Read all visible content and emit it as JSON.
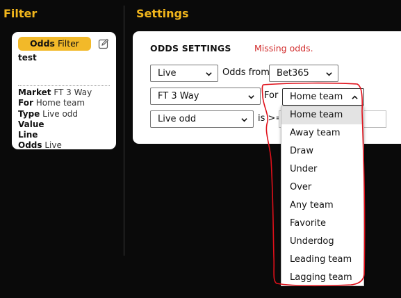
{
  "filter_section": {
    "heading": "Filter",
    "card": {
      "badge_bold": "Odds",
      "badge_rest": "Filter",
      "name": "test",
      "props": [
        {
          "key": "Market",
          "value": "FT 3 Way"
        },
        {
          "key": "For",
          "value": "Home team"
        },
        {
          "key": "Type",
          "value": "Live odd"
        },
        {
          "key": "Value",
          "value": ""
        },
        {
          "key": "Line",
          "value": ""
        },
        {
          "key": "Odds",
          "value": "Live"
        }
      ]
    }
  },
  "settings_section": {
    "heading": "Settings",
    "title": "ODDS SETTINGS",
    "warning": "Missing odds.",
    "mode_select": "Live",
    "odds_from_label": "Odds from",
    "bookmaker_select": "Bet365",
    "market_select": "FT 3 Way",
    "for_label": "For",
    "team_select": "Home team",
    "odd_type_select": "Live odd",
    "comparison_label": "is >=",
    "value_input": ""
  },
  "team_dropdown": {
    "options": [
      "Home team",
      "Away team",
      "Draw",
      "Under",
      "Over",
      "Any team",
      "Favorite",
      "Underdog",
      "Leading team",
      "Lagging team"
    ],
    "selected_index": 0
  },
  "colors": {
    "accent": "#f2b61c",
    "warning": "#d12b2b",
    "annotation": "#e0101a",
    "background": "#0a0a0a"
  }
}
